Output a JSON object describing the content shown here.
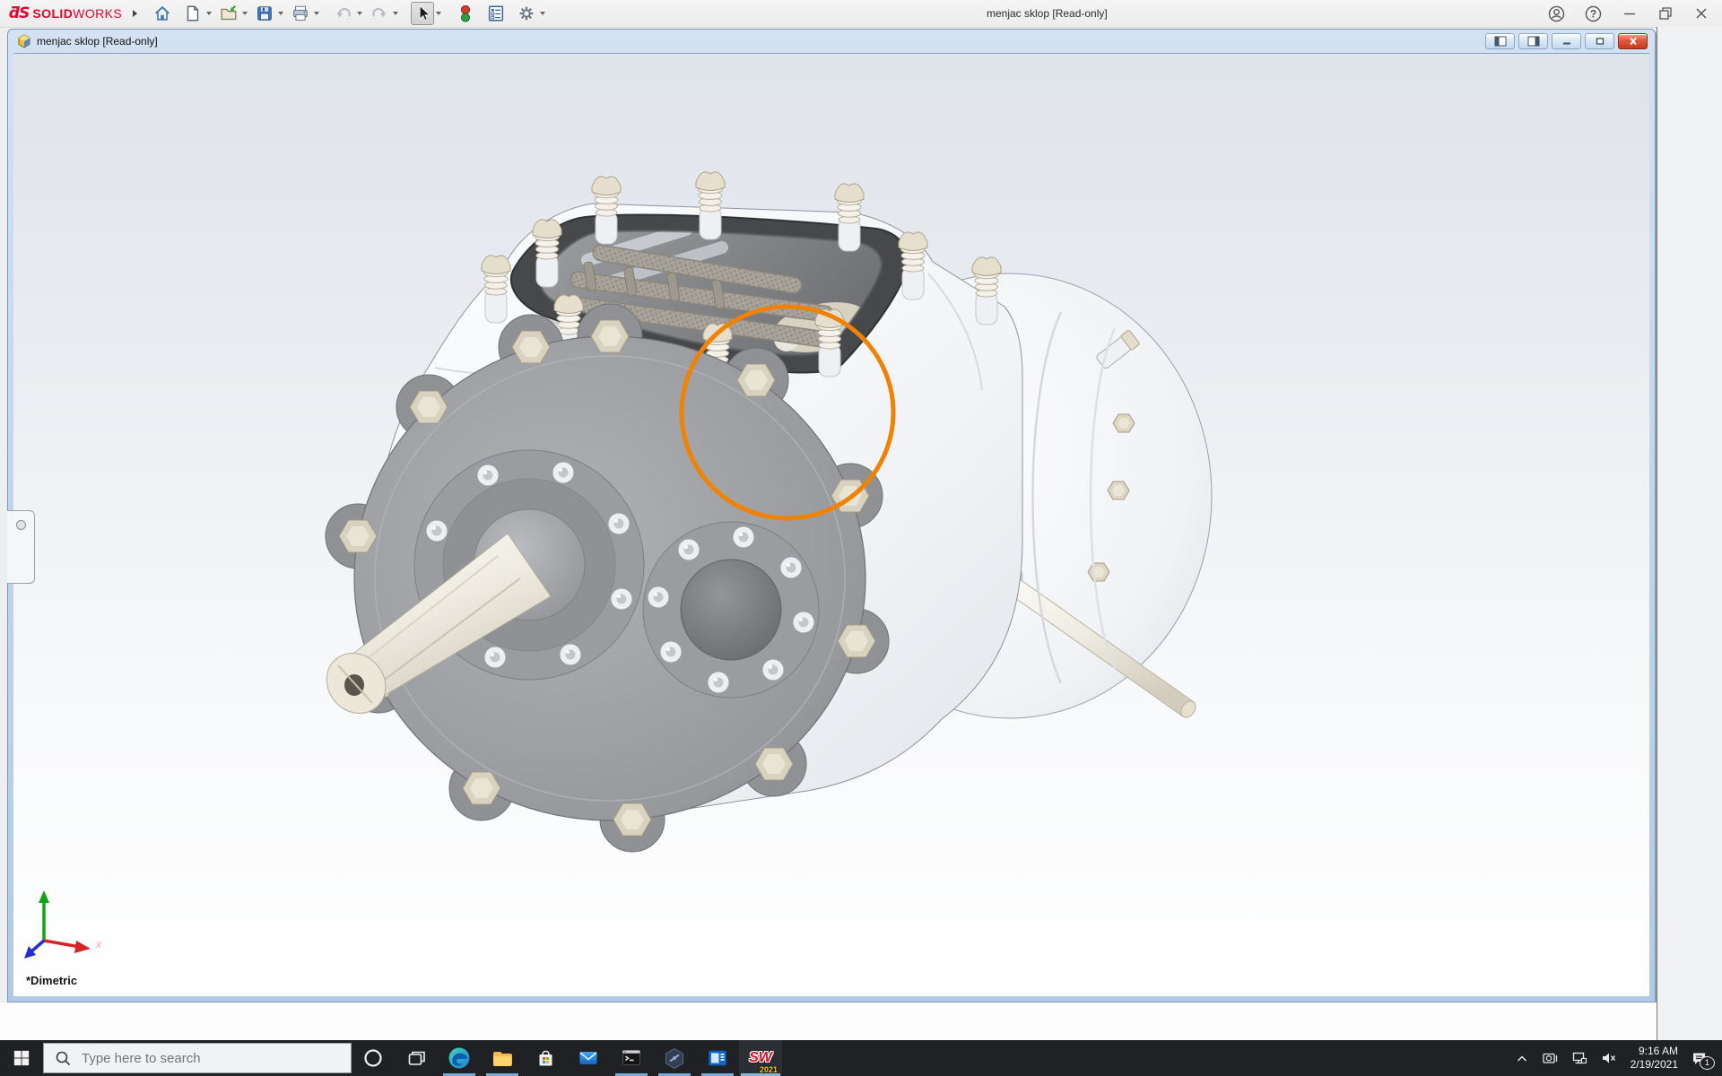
{
  "colors": {
    "brand_red": "#e4002b",
    "annotation_orange": "#ef8200",
    "taskbar_bg": "#1f2124",
    "taskbar_underline": "#75a8d4",
    "doc_close_red": "#d9512f",
    "viewport_gradient_top": "#dfe3ea",
    "viewport_gradient_bottom": "#ffffff"
  },
  "app_titlebar": {
    "logo_mark": "ƌS",
    "logo_solid": "SOLID",
    "logo_works": "WORKS",
    "title": "menjac sklop [Read-only]",
    "help_glyph": "?"
  },
  "document_window": {
    "title": "menjac sklop [Read-only]"
  },
  "viewport": {
    "orientation_label": "*Dimetric",
    "triad_x_label": "x"
  },
  "taskbar": {
    "search_placeholder": "Type here to search",
    "apps": [
      {
        "name": "edge",
        "open": true
      },
      {
        "name": "file-explorer",
        "open": true
      },
      {
        "name": "microsoft-store",
        "open": false
      },
      {
        "name": "mail",
        "open": false
      },
      {
        "name": "command-prompt",
        "open": true
      },
      {
        "name": "hexagon-app",
        "open": true
      },
      {
        "name": "media-app",
        "open": true
      },
      {
        "name": "solidworks-2021",
        "open": true,
        "active": true
      }
    ],
    "solidworks_icon": {
      "letters": "SW",
      "year": "2021"
    },
    "tray": {
      "time": "9:16 AM",
      "date": "2/19/2021",
      "notification_badge": "1"
    }
  }
}
